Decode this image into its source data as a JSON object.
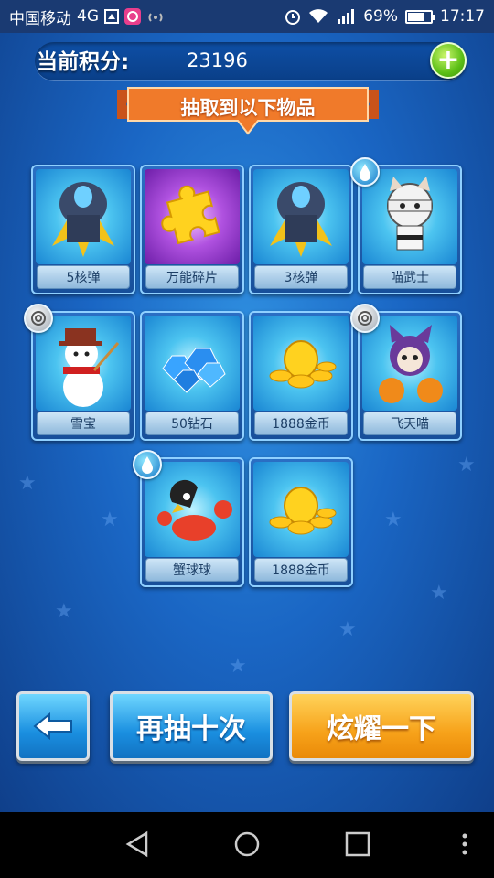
{
  "status_bar": {
    "carrier": "中国移动",
    "network": "4G",
    "battery_percent": "69%",
    "battery_level": 0.69,
    "time": "17:17",
    "icons": [
      "sim-icon",
      "app-icon",
      "hotspot-icon",
      "alarm-icon",
      "wifi-icon",
      "signal-icon",
      "battery-icon"
    ]
  },
  "header": {
    "score_label": "当前积分:",
    "score_value": "23196",
    "banner_title": "抽取到以下物品"
  },
  "items": [
    {
      "label": "5核弹",
      "icon": "rocket-icon",
      "badge": ""
    },
    {
      "label": "万能碎片",
      "icon": "puzzle-piece-icon",
      "badge": ""
    },
    {
      "label": "3核弹",
      "icon": "rocket-icon",
      "badge": ""
    },
    {
      "label": "喵武士",
      "icon": "ninja-cat-icon",
      "badge": "water"
    },
    {
      "label": "雪宝",
      "icon": "snowman-icon",
      "badge": "wind"
    },
    {
      "label": "50钻石",
      "icon": "diamonds-icon",
      "badge": ""
    },
    {
      "label": "1888金币",
      "icon": "gold-coins-icon",
      "badge": ""
    },
    {
      "label": "飞天喵",
      "icon": "flying-cat-icon",
      "badge": "wind"
    },
    {
      "label": "蟹球球",
      "icon": "crab-icon",
      "badge": "water"
    },
    {
      "label": "1888金币",
      "icon": "gold-coins-icon",
      "badge": ""
    }
  ],
  "buttons": {
    "back_icon": "back-arrow-icon",
    "draw_again_label": "再抽十次",
    "show_off_label": "炫耀一下"
  },
  "colors": {
    "background": "#1a66c4",
    "button_blue": "#1a8fe0",
    "button_orange": "#f7a21a",
    "banner_orange": "#f07a2a",
    "plus_green": "#5bbf16"
  },
  "nav_bar": {
    "icons": [
      "back-triangle-icon",
      "home-circle-icon",
      "recents-square-icon",
      "more-dots-icon"
    ]
  }
}
